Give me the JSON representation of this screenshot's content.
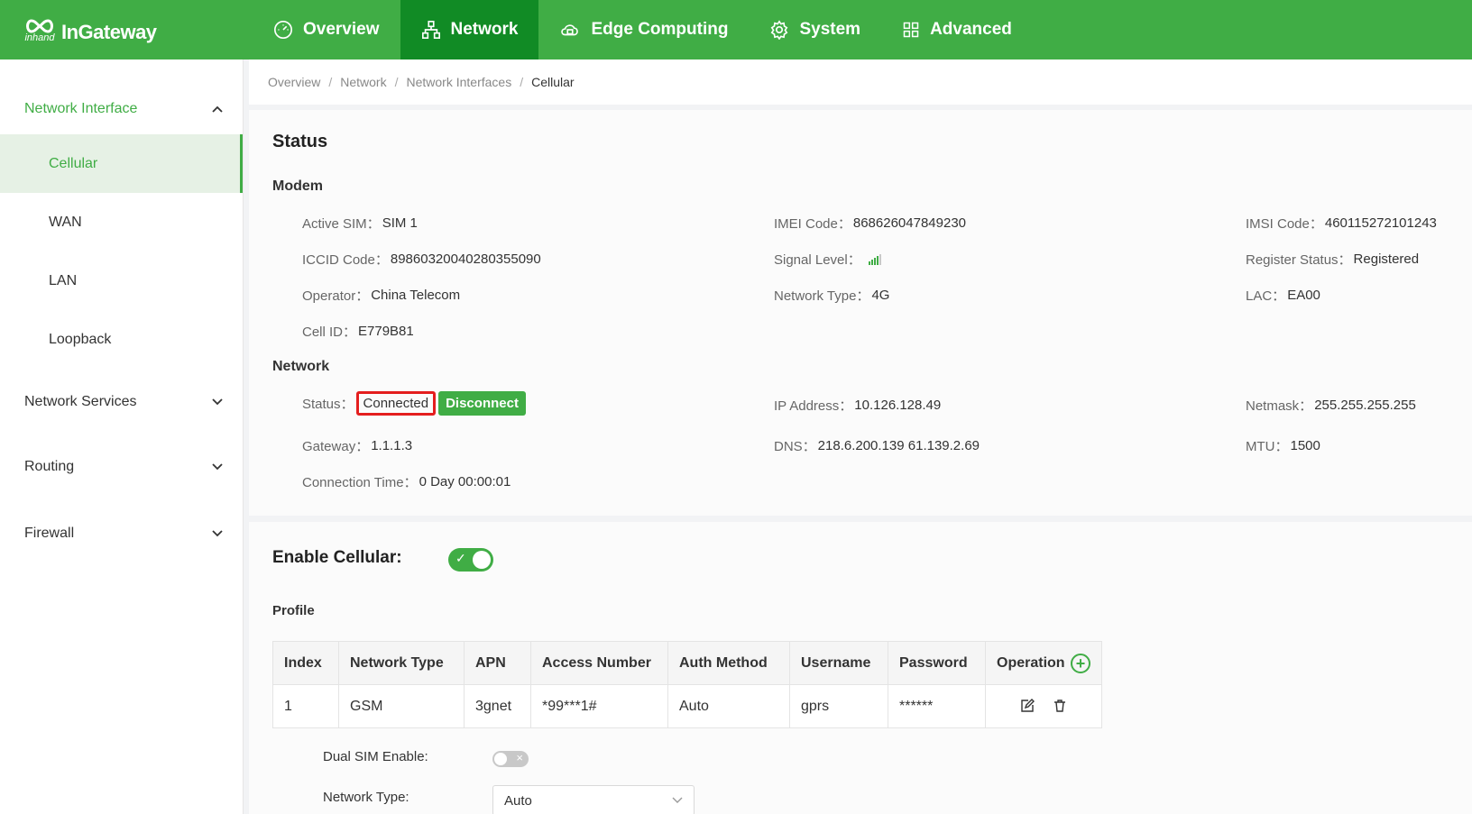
{
  "brand": {
    "name": "InGateway",
    "mark_text": "inhand"
  },
  "nav": {
    "items": [
      {
        "label": "Overview",
        "icon": "dashboard-icon"
      },
      {
        "label": "Network",
        "icon": "network-icon"
      },
      {
        "label": "Edge Computing",
        "icon": "cloud-icon"
      },
      {
        "label": "System",
        "icon": "gear-icon"
      },
      {
        "label": "Advanced",
        "icon": "grid-icon"
      }
    ],
    "active": "Network"
  },
  "sidebar": {
    "groups": [
      {
        "label": "Network Interface",
        "expanded": true
      },
      {
        "label": "Network Services",
        "expanded": false
      },
      {
        "label": "Routing",
        "expanded": false
      },
      {
        "label": "Firewall",
        "expanded": false
      }
    ],
    "items": [
      "Cellular",
      "WAN",
      "LAN",
      "Loopback"
    ],
    "active_item": "Cellular"
  },
  "breadcrumb": [
    "Overview",
    "Network",
    "Network Interfaces",
    "Cellular"
  ],
  "status": {
    "title": "Status",
    "modem_title": "Modem",
    "active_sim": {
      "label": "Active SIM：",
      "value": "SIM 1"
    },
    "imei": {
      "label": "IMEI Code：",
      "value": "868626047849230"
    },
    "imsi": {
      "label": "IMSI Code：",
      "value": "460115272101243"
    },
    "iccid": {
      "label": "ICCID Code：",
      "value": "89860320040280355090"
    },
    "signal": {
      "label": "Signal Level：",
      "bars": 4,
      "max_bars": 5
    },
    "register": {
      "label": "Register Status：",
      "value": "Registered"
    },
    "operator": {
      "label": "Operator：",
      "value": "China Telecom"
    },
    "network_type": {
      "label": "Network Type：",
      "value": "4G"
    },
    "lac": {
      "label": "LAC：",
      "value": "EA00"
    },
    "cell_id": {
      "label": "Cell ID：",
      "value": "E779B81"
    },
    "network_title": "Network",
    "conn_status": {
      "label": "Status：",
      "value": "Connected",
      "button": "Disconnect"
    },
    "ip": {
      "label": "IP Address：",
      "value": "10.126.128.49"
    },
    "netmask": {
      "label": "Netmask：",
      "value": "255.255.255.255"
    },
    "gateway": {
      "label": "Gateway：",
      "value": "1.1.1.3"
    },
    "dns": {
      "label": "DNS：",
      "value": "218.6.200.139 61.139.2.69"
    },
    "mtu": {
      "label": "MTU：",
      "value": "1500"
    },
    "conn_time": {
      "label": "Connection Time：",
      "value": "0 Day 00:00:01"
    }
  },
  "settings": {
    "enable_label": "Enable Cellular:",
    "enabled": true,
    "profile_title": "Profile",
    "table": {
      "headers": [
        "Index",
        "Network Type",
        "APN",
        "Access Number",
        "Auth Method",
        "Username",
        "Password",
        "Operation"
      ],
      "rows": [
        {
          "index": "1",
          "network_type": "GSM",
          "apn": "3gnet",
          "access_number": "*99***1#",
          "auth": "Auto",
          "username": "gprs",
          "password": "******"
        }
      ]
    },
    "dual_sim_label": "Dual SIM Enable:",
    "dual_sim_enabled": false,
    "network_type_label": "Network Type:",
    "network_type_value": "Auto"
  },
  "colors": {
    "primary": "#40ad45",
    "nav_active": "#118b25",
    "highlight": "#e41e1e"
  }
}
